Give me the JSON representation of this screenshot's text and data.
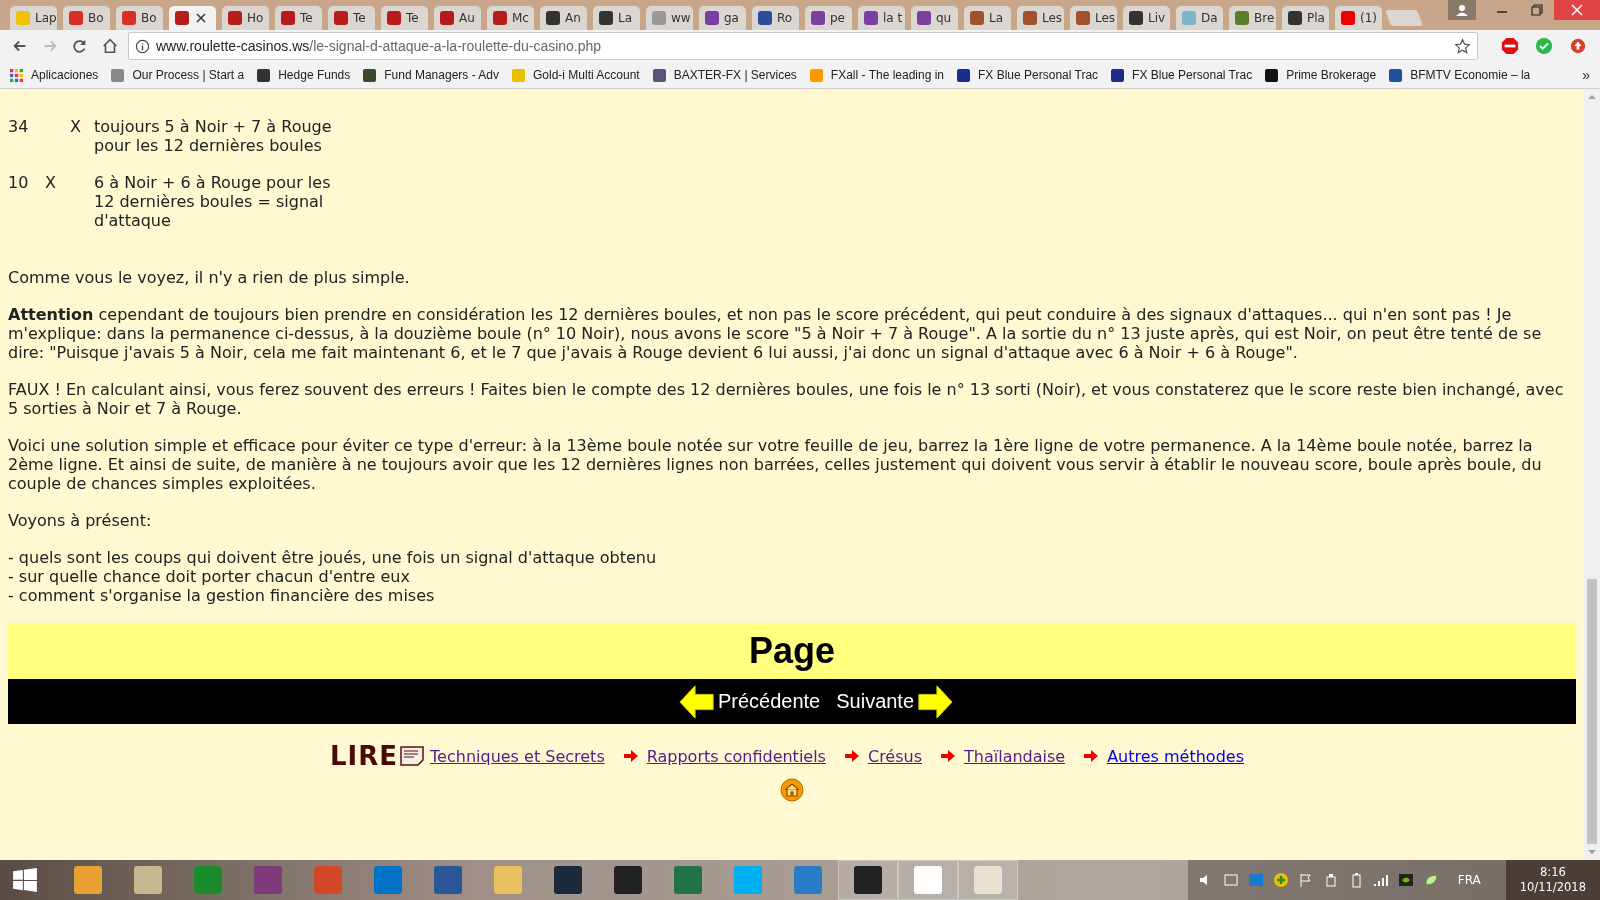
{
  "tabs": [
    {
      "label": "Lap",
      "selected": false
    },
    {
      "label": "Bo",
      "selected": false
    },
    {
      "label": "Bo",
      "selected": false
    },
    {
      "selected": true
    },
    {
      "label": "Ho",
      "selected": false
    },
    {
      "label": "Te",
      "selected": false
    },
    {
      "label": "Te",
      "selected": false
    },
    {
      "label": "Te",
      "selected": false
    },
    {
      "label": "Au",
      "selected": false
    },
    {
      "label": "Mc",
      "selected": false
    },
    {
      "label": "An",
      "selected": false
    },
    {
      "label": "La",
      "selected": false
    },
    {
      "label": "ww",
      "selected": false
    },
    {
      "label": "ga",
      "selected": false
    },
    {
      "label": "Ro",
      "selected": false
    },
    {
      "label": "pe",
      "selected": false
    },
    {
      "label": "la t",
      "selected": false
    },
    {
      "label": "qu",
      "selected": false
    },
    {
      "label": "La",
      "selected": false
    },
    {
      "label": "Les",
      "selected": false
    },
    {
      "label": "Les",
      "selected": false
    },
    {
      "label": "Liv",
      "selected": false
    },
    {
      "label": "Da",
      "selected": false
    },
    {
      "label": "Bre",
      "selected": false
    },
    {
      "label": "Pla",
      "selected": false
    },
    {
      "label": "(1)",
      "selected": false
    }
  ],
  "address_bar": {
    "domain": "www.roulette-casinos.ws",
    "path": "/le-signal-d-attaque-a-la-roulette-du-casino.php"
  },
  "bookmarks": [
    "Aplicaciones",
    "Our Process | Start a",
    "Hedge Funds",
    "Fund Managers - Adv",
    "Gold-i Multi Account",
    "BAXTER-FX | Services",
    "FXall - The leading in",
    "FX Blue Personal Trac",
    "FX Blue Personal Trac",
    "Prime Brokerage",
    "BFMTV Economie – la"
  ],
  "bookmarks_more": "»",
  "permanence": [
    {
      "number": "34",
      "mark": "X",
      "kind": "right",
      "text": "toujours 5 à Noir + 7 à Rouge pour les 12 dernières boules"
    },
    {
      "number": "10",
      "mark": "X",
      "kind": "left",
      "text": "6 à Noir + 6 à Rouge pour les 12 dernières boules = signal d'attaque"
    }
  ],
  "paragraphs": [
    "Comme vous le voyez, il n'y a rien de plus simple.",
    "**Attention** cependant de toujours bien prendre en considération les 12 dernières boules, et non pas le score précédent, qui peut conduire à des signaux d'attaques... qui n'en sont pas ! Je m'explique: dans la permanence ci-dessus, à la douzième boule (n° 10 Noir), nous avons le score \"5 à Noir + 7 à Rouge\". A la sortie du n° 13 juste après, qui est Noir, on peut être tenté de se dire: \"Puisque j'avais 5 à Noir, cela me fait maintenant 6, et le 7 que j'avais à Rouge devient 6 lui aussi, j'ai donc un signal d'attaque avec 6 à Noir + 6 à Rouge\".",
    "FAUX ! En calculant ainsi, vous ferez souvent des erreurs ! Faites bien le compte des 12 dernières boules, une fois le n° 13 sorti (Noir), et vous constaterez que le score reste bien inchangé, avec 5 sorties à Noir et 7 à Rouge.",
    "Voici une solution simple et efficace pour éviter ce type d'erreur: à la 13ème boule notée sur votre feuille de jeu, barrez la 1ère ligne de votre permanence. A la 14ème boule notée, barrez la 2ème ligne. Et ainsi de suite, de manière à ne toujours avoir que les 12 dernières lignes non barrées, celles justement qui doivent vous servir à établir le nouveau score, boule après boule, du couple de chances simples exploitées.",
    "Voyons à présent:"
  ],
  "list": [
    "- quels sont les coups qui doivent être joués, une fois un signal d'attaque obtenu",
    "- sur quelle chance doit porter chacun d'entre eux",
    "- comment s'organise la gestion financière des mises"
  ],
  "page_nav": {
    "title": "Page",
    "previous": "Précédente",
    "next": "Suivante"
  },
  "read_logo": "LIRE",
  "links": [
    {
      "label": "Techniques et Secrets",
      "visited": true
    },
    {
      "label": "Rapports confidentiels",
      "visited": true
    },
    {
      "label": "Crésus",
      "visited": true
    },
    {
      "label": "Thaïlandaise",
      "visited": true
    },
    {
      "label": "Autres méthodes",
      "visited": false
    }
  ],
  "taskbar": {
    "language": "FRA",
    "time": "8:16",
    "date": "10/11/2018"
  }
}
